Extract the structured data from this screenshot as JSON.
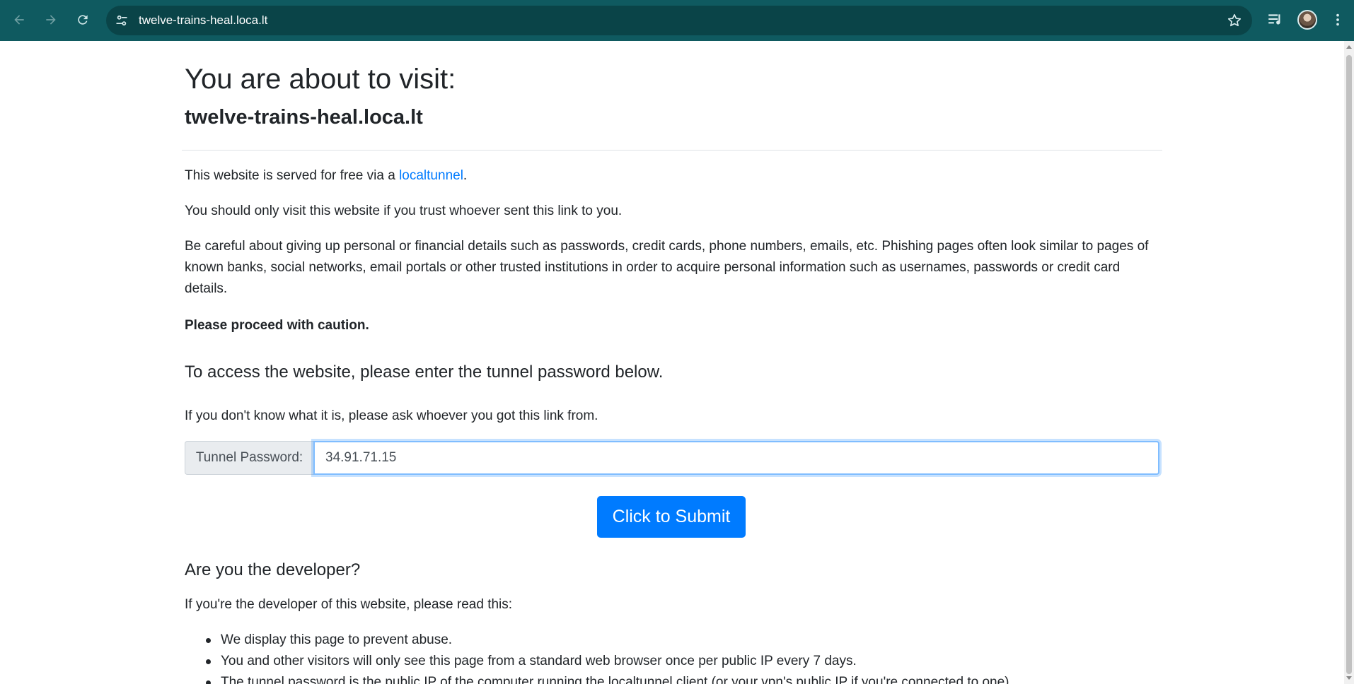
{
  "browser": {
    "url": "twelve-trains-heal.loca.lt"
  },
  "page": {
    "title": "You are about to visit:",
    "host": "twelve-trains-heal.loca.lt",
    "intro_prefix": "This website is served for free via a ",
    "intro_link": "localtunnel",
    "intro_suffix": ".",
    "trust_notice": "You should only visit this website if you trust whoever sent this link to you.",
    "warning": "Be careful about giving up personal or financial details such as passwords, credit cards, phone numbers, emails, etc. Phishing pages often look similar to pages of known banks, social networks, email portals or other trusted institutions in order to acquire personal information such as usernames, passwords or credit card details.",
    "caution": "Please proceed with caution.",
    "access_heading": "To access the website, please enter the tunnel password below.",
    "access_help": "If you don't know what it is, please ask whoever you got this link from.",
    "password_label": "Tunnel Password:",
    "password_value": "34.91.71.15",
    "submit_label": "Click to Submit",
    "dev_heading": "Are you the developer?",
    "dev_intro": "If you're the developer of this website, please read this:",
    "dev_points": [
      "We display this page to prevent abuse.",
      "You and other visitors will only see this page from a standard web browser once per public IP every 7 days.",
      "The tunnel password is the public IP of the computer running the localtunnel client (or your vpn's public IP if you're connected to one)."
    ]
  }
}
